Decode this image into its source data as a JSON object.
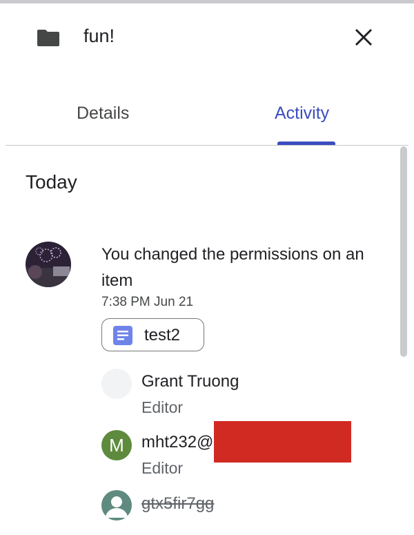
{
  "header": {
    "title": "fun!",
    "folder_icon": "folder-icon",
    "close_icon": "close-icon"
  },
  "tabs": [
    {
      "label": "Details",
      "active": false
    },
    {
      "label": "Activity",
      "active": true
    }
  ],
  "colors": {
    "accent": "#3b4cc0",
    "redaction": "#d12a22",
    "avatar_m": "#5e8a3d",
    "avatar_generic": "#5f8a7f"
  },
  "activity": {
    "section_title": "Today",
    "event": {
      "text": "You changed the permissions on an item",
      "time": "7:38 PM Jun 21",
      "file": {
        "name": "test2",
        "icon": "doc-icon"
      }
    },
    "people": [
      {
        "name": "Grant Truong",
        "role": "Editor",
        "removed": false
      },
      {
        "name": "mht232@",
        "role": "Editor",
        "initial": "M",
        "removed": false,
        "redacted": true
      },
      {
        "name": "gtx5fir7gg",
        "role": "",
        "removed": true
      }
    ]
  }
}
